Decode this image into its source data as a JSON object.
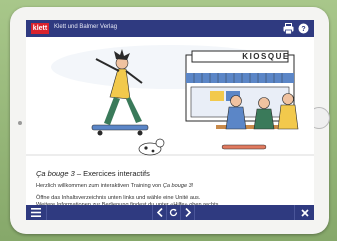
{
  "app": {
    "publisher": "Klett und Balmer Verlag",
    "logo_text": "klett"
  },
  "scene": {
    "kiosk_sign": "KIOSQUE"
  },
  "intro": {
    "title_italic": "Ça bouge 3",
    "title_rest": " – Exercices interactifs",
    "welcome_prefix": "Herzlich willkommen zum interaktiven Training von ",
    "welcome_italic": "Ça bouge 3",
    "welcome_suffix": "!",
    "line2": "Öffne das Inhaltsverzeichnis unten links und wähle eine Unité aus.",
    "line3": "Weitere Informationen zur Bedienung findest du unter «Hilfe» oben rechts."
  },
  "toolbar": {
    "menu_icon": "hamburger-menu-icon",
    "prev_icon": "chevron-left-icon",
    "reload_icon": "reload-icon",
    "next_icon": "chevron-right-icon",
    "close_icon": "close-icon",
    "print_icon": "print-icon",
    "help_icon": "help-icon"
  },
  "colors": {
    "bar": "#2f3a80",
    "logo": "#d9232e"
  }
}
